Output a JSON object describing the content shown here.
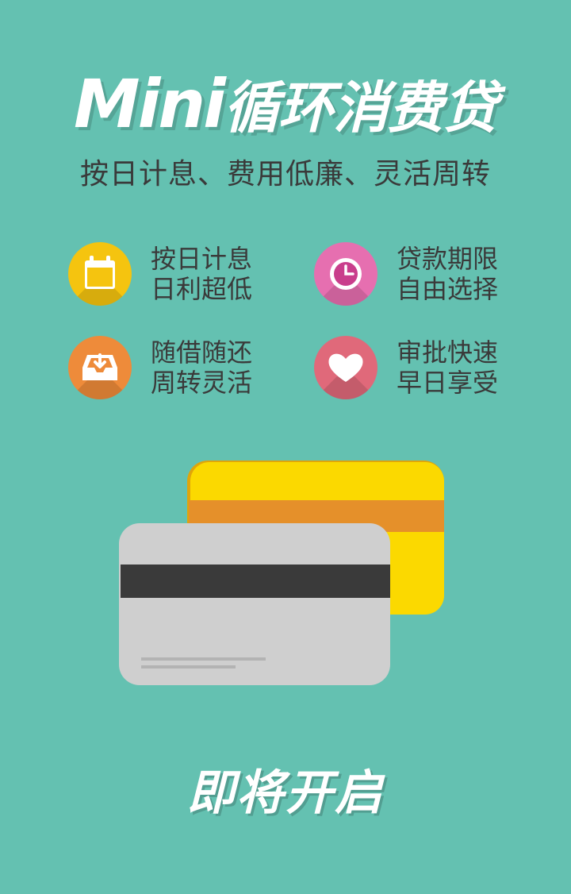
{
  "hero": {
    "title_prefix": "Mini",
    "title_suffix": "循环消费贷",
    "subtitle": "按日计息、费用低廉、灵活周转"
  },
  "features": [
    {
      "icon": "calendar-icon",
      "color": "#f5c40f",
      "line1": "按日计息",
      "line2": "日利超低"
    },
    {
      "icon": "clock-icon",
      "color": "#e66fb0",
      "line1": "贷款期限",
      "line2": "自由选择"
    },
    {
      "icon": "inbox-download-icon",
      "color": "#ee8b3a",
      "line1": "随借随还",
      "line2": "周转灵活"
    },
    {
      "icon": "heart-icon",
      "color": "#e0697a",
      "line1": "审批快速",
      "line2": "早日享受"
    }
  ],
  "cta": {
    "label": "即将开启"
  }
}
